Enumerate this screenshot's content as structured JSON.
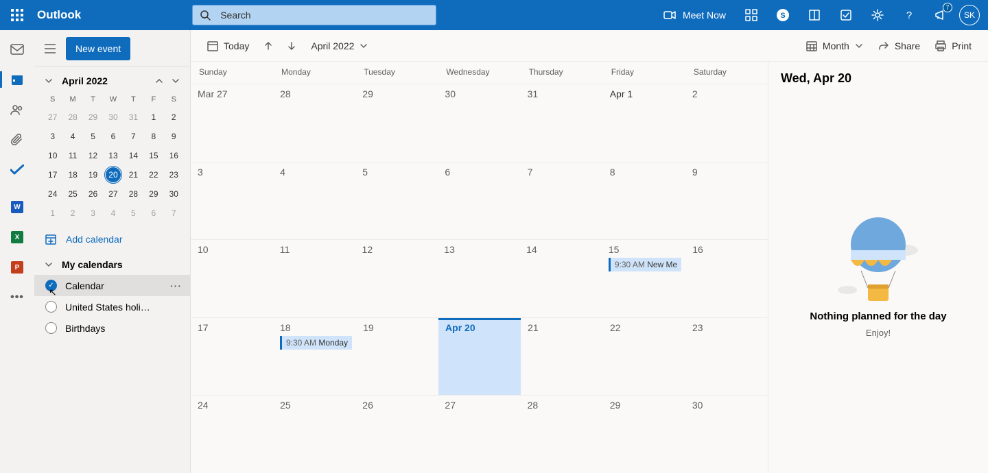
{
  "topbar": {
    "brand": "Outlook",
    "search_placeholder": "Search",
    "meet_now": "Meet Now",
    "notif_badge": "7",
    "avatar_initials": "SK"
  },
  "sidebar": {
    "new_event": "New event",
    "picker_month": "April 2022",
    "dow": [
      "S",
      "M",
      "T",
      "W",
      "T",
      "F",
      "S"
    ],
    "mini_weeks": [
      [
        {
          "n": "27",
          "out": true
        },
        {
          "n": "28",
          "out": true
        },
        {
          "n": "29",
          "out": true
        },
        {
          "n": "30",
          "out": true
        },
        {
          "n": "31",
          "out": true
        },
        {
          "n": "1"
        },
        {
          "n": "2"
        }
      ],
      [
        {
          "n": "3"
        },
        {
          "n": "4"
        },
        {
          "n": "5"
        },
        {
          "n": "6"
        },
        {
          "n": "7"
        },
        {
          "n": "8"
        },
        {
          "n": "9"
        }
      ],
      [
        {
          "n": "10"
        },
        {
          "n": "11"
        },
        {
          "n": "12"
        },
        {
          "n": "13"
        },
        {
          "n": "14"
        },
        {
          "n": "15"
        },
        {
          "n": "16"
        }
      ],
      [
        {
          "n": "17"
        },
        {
          "n": "18"
        },
        {
          "n": "19"
        },
        {
          "n": "20",
          "today": true
        },
        {
          "n": "21"
        },
        {
          "n": "22"
        },
        {
          "n": "23"
        }
      ],
      [
        {
          "n": "24"
        },
        {
          "n": "25"
        },
        {
          "n": "26"
        },
        {
          "n": "27"
        },
        {
          "n": "28"
        },
        {
          "n": "29"
        },
        {
          "n": "30"
        }
      ],
      [
        {
          "n": "1",
          "out": true
        },
        {
          "n": "2",
          "out": true
        },
        {
          "n": "3",
          "out": true
        },
        {
          "n": "4",
          "out": true
        },
        {
          "n": "5",
          "out": true
        },
        {
          "n": "6",
          "out": true
        },
        {
          "n": "7",
          "out": true
        }
      ]
    ],
    "add_calendar": "Add calendar",
    "group_label": "My calendars",
    "calendars": [
      {
        "label": "Calendar",
        "checked": true,
        "hover": true
      },
      {
        "label": "United States holi…",
        "checked": false
      },
      {
        "label": "Birthdays",
        "checked": false
      }
    ]
  },
  "toolbar": {
    "today": "Today",
    "range": "April 2022",
    "view_label": "Month",
    "share": "Share",
    "print": "Print"
  },
  "grid": {
    "day_headers": [
      "Sunday",
      "Monday",
      "Tuesday",
      "Wednesday",
      "Thursday",
      "Friday",
      "Saturday"
    ],
    "weeks": [
      [
        {
          "n": "Mar 27"
        },
        {
          "n": "28"
        },
        {
          "n": "29"
        },
        {
          "n": "30"
        },
        {
          "n": "31"
        },
        {
          "n": "Apr 1",
          "bold": true
        },
        {
          "n": "2"
        }
      ],
      [
        {
          "n": "3"
        },
        {
          "n": "4"
        },
        {
          "n": "5"
        },
        {
          "n": "6"
        },
        {
          "n": "7"
        },
        {
          "n": "8"
        },
        {
          "n": "9"
        }
      ],
      [
        {
          "n": "10"
        },
        {
          "n": "11"
        },
        {
          "n": "12"
        },
        {
          "n": "13"
        },
        {
          "n": "14"
        },
        {
          "n": "15",
          "event": {
            "time": "9:30 AM",
            "title": "New Me"
          }
        },
        {
          "n": "16"
        }
      ],
      [
        {
          "n": "17"
        },
        {
          "n": "18",
          "event": {
            "time": "9:30 AM",
            "title": "Monday"
          }
        },
        {
          "n": "19"
        },
        {
          "n": "Apr 20",
          "today": true
        },
        {
          "n": "21"
        },
        {
          "n": "22"
        },
        {
          "n": "23"
        }
      ],
      [
        {
          "n": "24"
        },
        {
          "n": "25"
        },
        {
          "n": "26"
        },
        {
          "n": "27"
        },
        {
          "n": "28"
        },
        {
          "n": "29"
        },
        {
          "n": "30"
        }
      ]
    ]
  },
  "detail": {
    "title": "Wed, Apr 20",
    "empty_title": "Nothing planned for the day",
    "empty_sub": "Enjoy!"
  }
}
